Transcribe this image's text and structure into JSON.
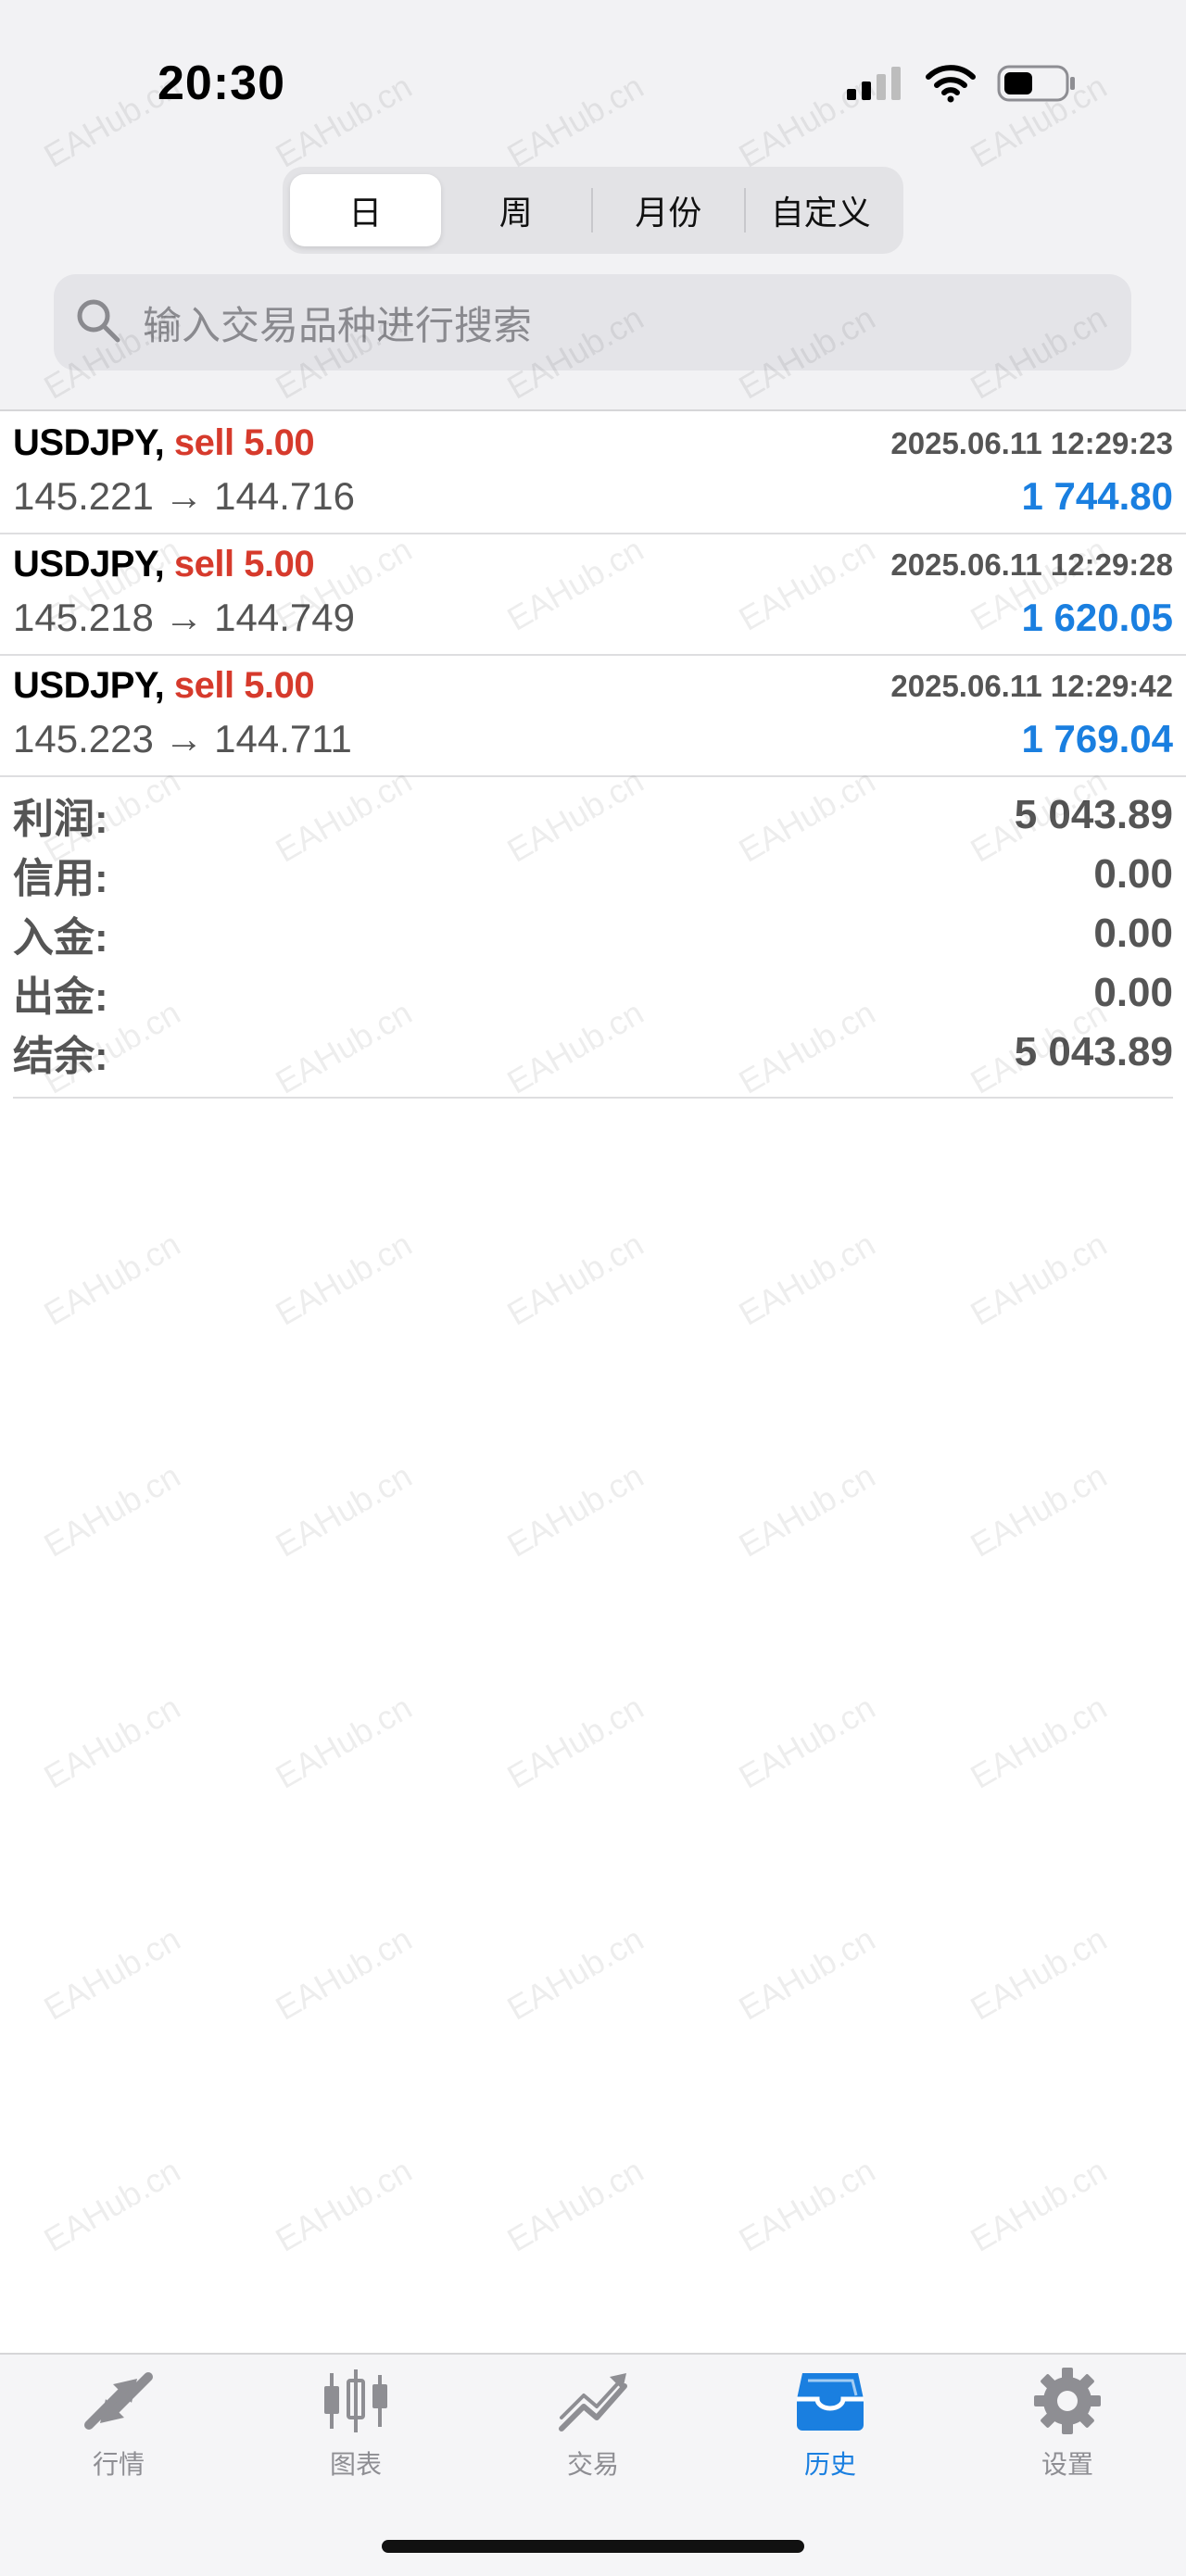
{
  "status_bar": {
    "time": "20:30"
  },
  "period_tabs": [
    {
      "label": "日",
      "active": true
    },
    {
      "label": "周",
      "active": false
    },
    {
      "label": "月份",
      "active": false
    },
    {
      "label": "自定义",
      "active": false
    }
  ],
  "search": {
    "placeholder": "输入交易品种进行搜索"
  },
  "trades": [
    {
      "symbol": "USDJPY,",
      "side": "sell 5.00",
      "datetime": "2025.06.11 12:29:23",
      "prices": "145.221 → 144.716",
      "profit": "1 744.80"
    },
    {
      "symbol": "USDJPY,",
      "side": "sell 5.00",
      "datetime": "2025.06.11 12:29:28",
      "prices": "145.218 → 144.749",
      "profit": "1 620.05"
    },
    {
      "symbol": "USDJPY,",
      "side": "sell 5.00",
      "datetime": "2025.06.11 12:29:42",
      "prices": "145.223 → 144.711",
      "profit": "1 769.04"
    }
  ],
  "summary": [
    {
      "label": "利润:",
      "value": "5 043.89"
    },
    {
      "label": "信用:",
      "value": "0.00"
    },
    {
      "label": "入金:",
      "value": "0.00"
    },
    {
      "label": "出金:",
      "value": "0.00"
    },
    {
      "label": "结余:",
      "value": "5 043.89"
    }
  ],
  "tabbar": [
    {
      "label": "行情",
      "icon": "quotes-arrows-icon",
      "active": false
    },
    {
      "label": "图表",
      "icon": "candlestick-chart-icon",
      "active": false
    },
    {
      "label": "交易",
      "icon": "trade-trend-icon",
      "active": false
    },
    {
      "label": "历史",
      "icon": "history-inbox-icon",
      "active": true
    },
    {
      "label": "设置",
      "icon": "gear-icon",
      "active": false
    }
  ],
  "watermark": "EAHub.cn",
  "colors": {
    "sell": "#d63a2c",
    "profit": "#1a7fe0",
    "active_tab": "#1a7fe0",
    "inactive_tab": "#8e8e93"
  }
}
